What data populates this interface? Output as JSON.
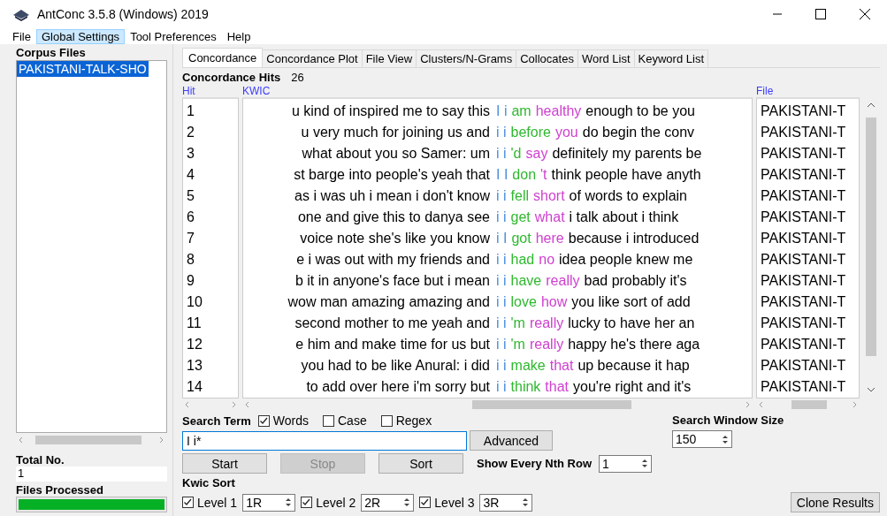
{
  "window": {
    "title": "AntConc 3.5.8 (Windows) 2019"
  },
  "menu": [
    {
      "label": "File",
      "selected": false
    },
    {
      "label": "Global Settings",
      "selected": true
    },
    {
      "label": "Tool Preferences",
      "selected": false
    },
    {
      "label": "Help",
      "selected": false
    }
  ],
  "corpus_files": {
    "heading": "Corpus Files",
    "items": [
      {
        "name": "PAKISTANI-TALK-SHO",
        "selected": true
      }
    ]
  },
  "total_no": {
    "label": "Total No.",
    "value": "1"
  },
  "files_processed": {
    "label": "Files Processed",
    "level": 1
  },
  "tabs": [
    {
      "label": "Concordance",
      "selected": true
    },
    {
      "label": "Concordance Plot",
      "selected": false
    },
    {
      "label": "File View",
      "selected": false
    },
    {
      "label": "Clusters/N-Grams",
      "selected": false
    },
    {
      "label": "Collocates",
      "selected": false
    },
    {
      "label": "Word List",
      "selected": false
    },
    {
      "label": "Keyword List",
      "selected": false
    }
  ],
  "hits": {
    "label": "Concordance Hits",
    "count": "26"
  },
  "columns": [
    "Hit",
    "KWIC",
    "File"
  ],
  "rows": [
    {
      "hit": "1",
      "left": "u kind of inspired me to say this",
      "key": "I i",
      "r1": "am",
      "r2": "healthy",
      "right": "enough to be you",
      "file": "PAKISTANI-T"
    },
    {
      "hit": "2",
      "left": "u very much for joining us and",
      "key": "i i",
      "r1": "before",
      "r2": "you",
      "right": "do begin the conv",
      "file": "PAKISTANI-T"
    },
    {
      "hit": "3",
      "left": "what about you so  Samer:  um",
      "key": "i i",
      "r1": "'d",
      "r2": "say",
      "right": "definitely my parents be",
      "file": "PAKISTANI-T"
    },
    {
      "hit": "4",
      "left": "st barge into people's yeah that",
      "key": "I I",
      "r1": "don",
      "r2": "'t",
      "right": "think people have anyth",
      "file": "PAKISTANI-T"
    },
    {
      "hit": "5",
      "left": "as i was uh i mean i don't know",
      "key": "i i",
      "r1": "fell",
      "r2": "short",
      "right": "of words to explain",
      "file": "PAKISTANI-T"
    },
    {
      "hit": "6",
      "left": "one and give this to danya see",
      "key": "i i",
      "r1": "get",
      "r2": "what",
      "right": "i talk about i think",
      "file": "PAKISTANI-T"
    },
    {
      "hit": "7",
      "left": "voice note she's like you know",
      "key": "i I",
      "r1": "got",
      "r2": "here",
      "right": "because i introduced",
      "file": "PAKISTANI-T"
    },
    {
      "hit": "8",
      "left": "e i was out with my friends and",
      "key": "i i",
      "r1": "had",
      "r2": "no",
      "right": "idea people knew me",
      "file": "PAKISTANI-T"
    },
    {
      "hit": "9",
      "left": "b it in anyone's face but i mean",
      "key": "i i",
      "r1": "have",
      "r2": "really",
      "right": "bad probably it's",
      "file": "PAKISTANI-T"
    },
    {
      "hit": "10",
      "left": "wow man amazing amazing and",
      "key": "i i",
      "r1": "love",
      "r2": "how",
      "right": "you like sort of add",
      "file": "PAKISTANI-T"
    },
    {
      "hit": "11",
      "left": "second mother to me yeah and",
      "key": "i i",
      "r1": "'m",
      "r2": "really",
      "right": "lucky to have her an",
      "file": "PAKISTANI-T"
    },
    {
      "hit": "12",
      "left": "e him and make time for us but",
      "key": "i i",
      "r1": "'m",
      "r2": "really",
      "right": "happy he's there aga",
      "file": "PAKISTANI-T"
    },
    {
      "hit": "13",
      "left": "you had to be like   Anural: i did",
      "key": "i i",
      "r1": "make",
      "r2": "that",
      "right": "up because it  hap",
      "file": "PAKISTANI-T"
    },
    {
      "hit": "14",
      "left": "to add over here i'm sorry  but",
      "key": "i i",
      "r1": "think",
      "r2": "that",
      "right": "you're right and it's",
      "file": "PAKISTANI-T"
    }
  ],
  "search": {
    "label": "Search Term",
    "options": [
      {
        "label": "Words",
        "checked": true
      },
      {
        "label": "Case",
        "checked": false
      },
      {
        "label": "Regex",
        "checked": false
      }
    ],
    "value": "I i*",
    "advanced": "Advanced"
  },
  "window_size": {
    "label": "Search Window Size",
    "value": "150"
  },
  "buttons": [
    {
      "label": "Start",
      "disabled": false
    },
    {
      "label": "Stop",
      "disabled": true
    },
    {
      "label": "Sort",
      "disabled": false
    }
  ],
  "nth_row": {
    "label": "Show Every Nth Row",
    "value": "1"
  },
  "kwic_sort": {
    "label": "Kwic Sort",
    "levels": [
      {
        "label": "Level 1",
        "checked": true,
        "value": "1R"
      },
      {
        "label": "Level 2",
        "checked": true,
        "value": "2R"
      },
      {
        "label": "Level 3",
        "checked": true,
        "value": "3R"
      }
    ]
  },
  "clone": "Clone Results"
}
